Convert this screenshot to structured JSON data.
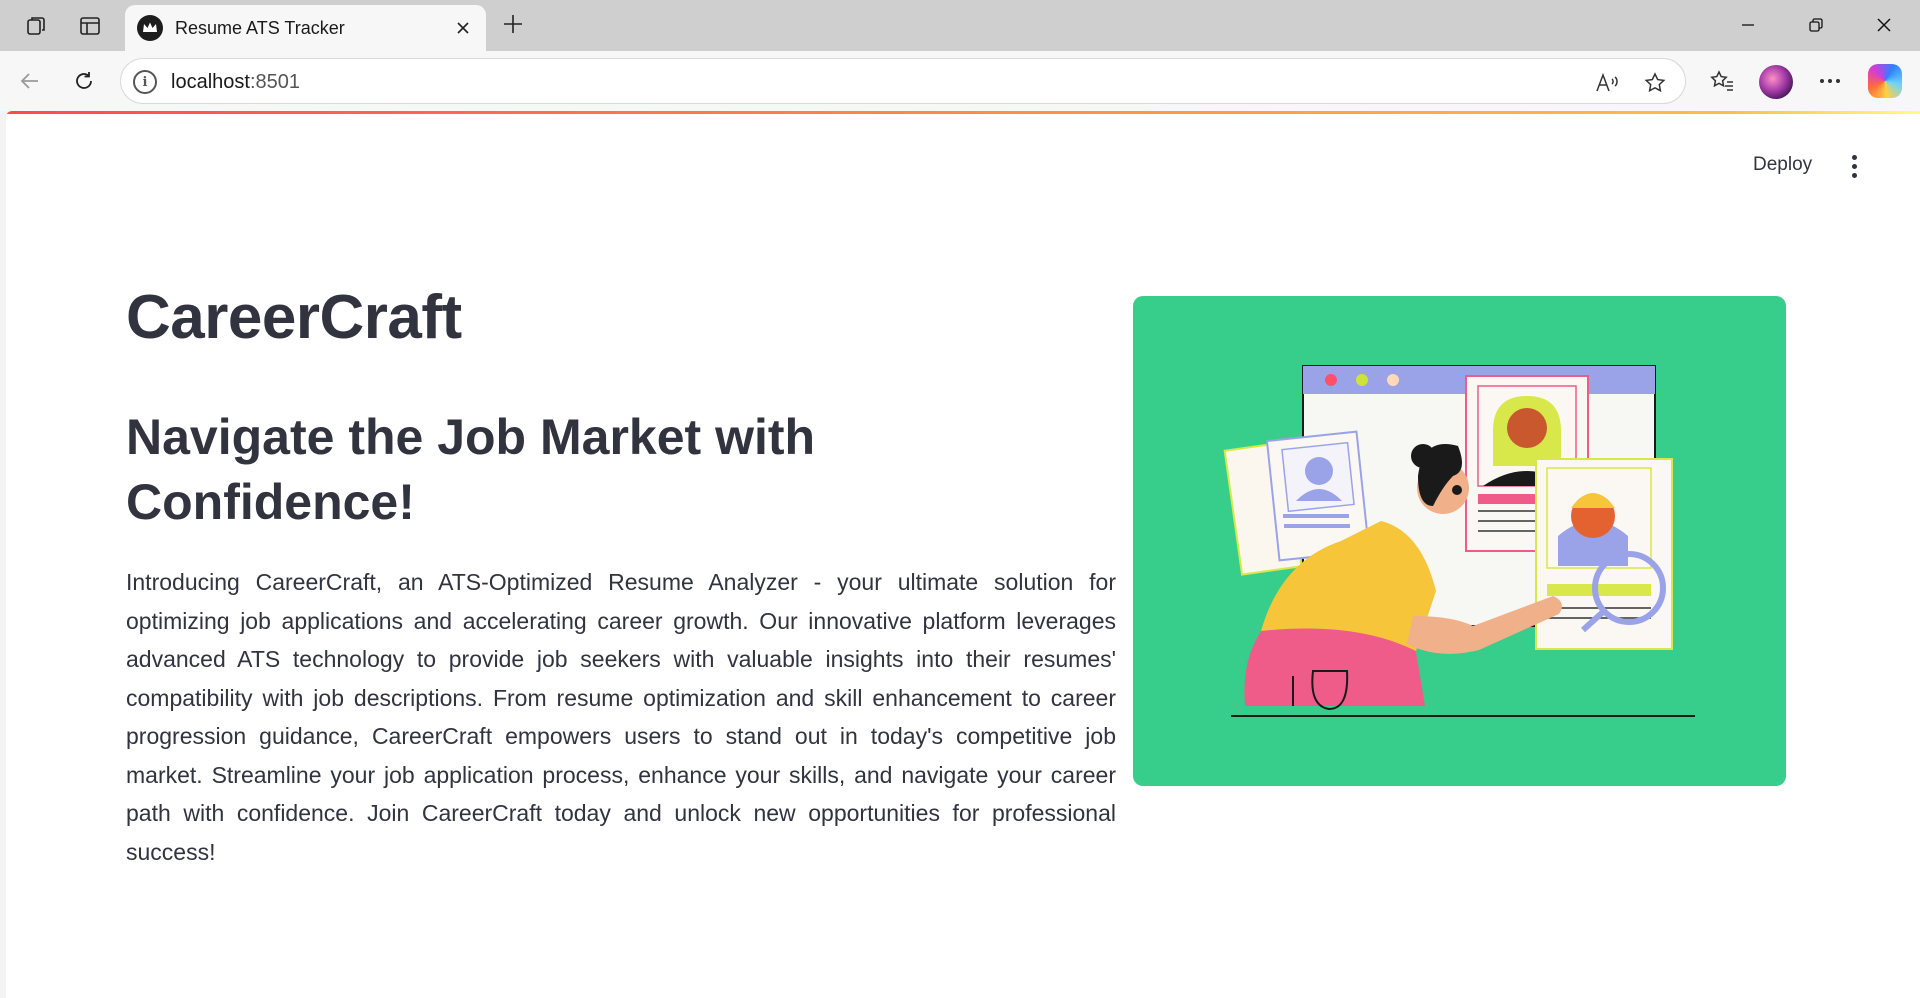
{
  "browser": {
    "tab": {
      "title": "Resume ATS Tracker"
    },
    "address": {
      "host": "localhost",
      "port": ":8501"
    }
  },
  "app": {
    "toolbar": {
      "deploy_label": "Deploy"
    },
    "title": "CareerCraft",
    "headline": "Navigate the Job Market with Confidence!",
    "intro": "Introducing CareerCraft, an ATS-Optimized Resume Analyzer - your ultimate solution for optimizing job applications and accelerating career growth. Our innovative platform leverages advanced ATS technology to provide job seekers with valuable insights into their resumes' compatibility with job descriptions. From resume optimization and skill enhancement to career progression guidance, CareerCraft empowers users to stand out in today's competitive job market. Streamline your job application process, enhance your skills, and navigate your career path with confidence. Join CareerCraft today and unlock new opportunities for professional success!",
    "colors": {
      "accent": "#ff4b4b",
      "text": "#31333f",
      "hero_bg": "#37cd8a"
    }
  }
}
